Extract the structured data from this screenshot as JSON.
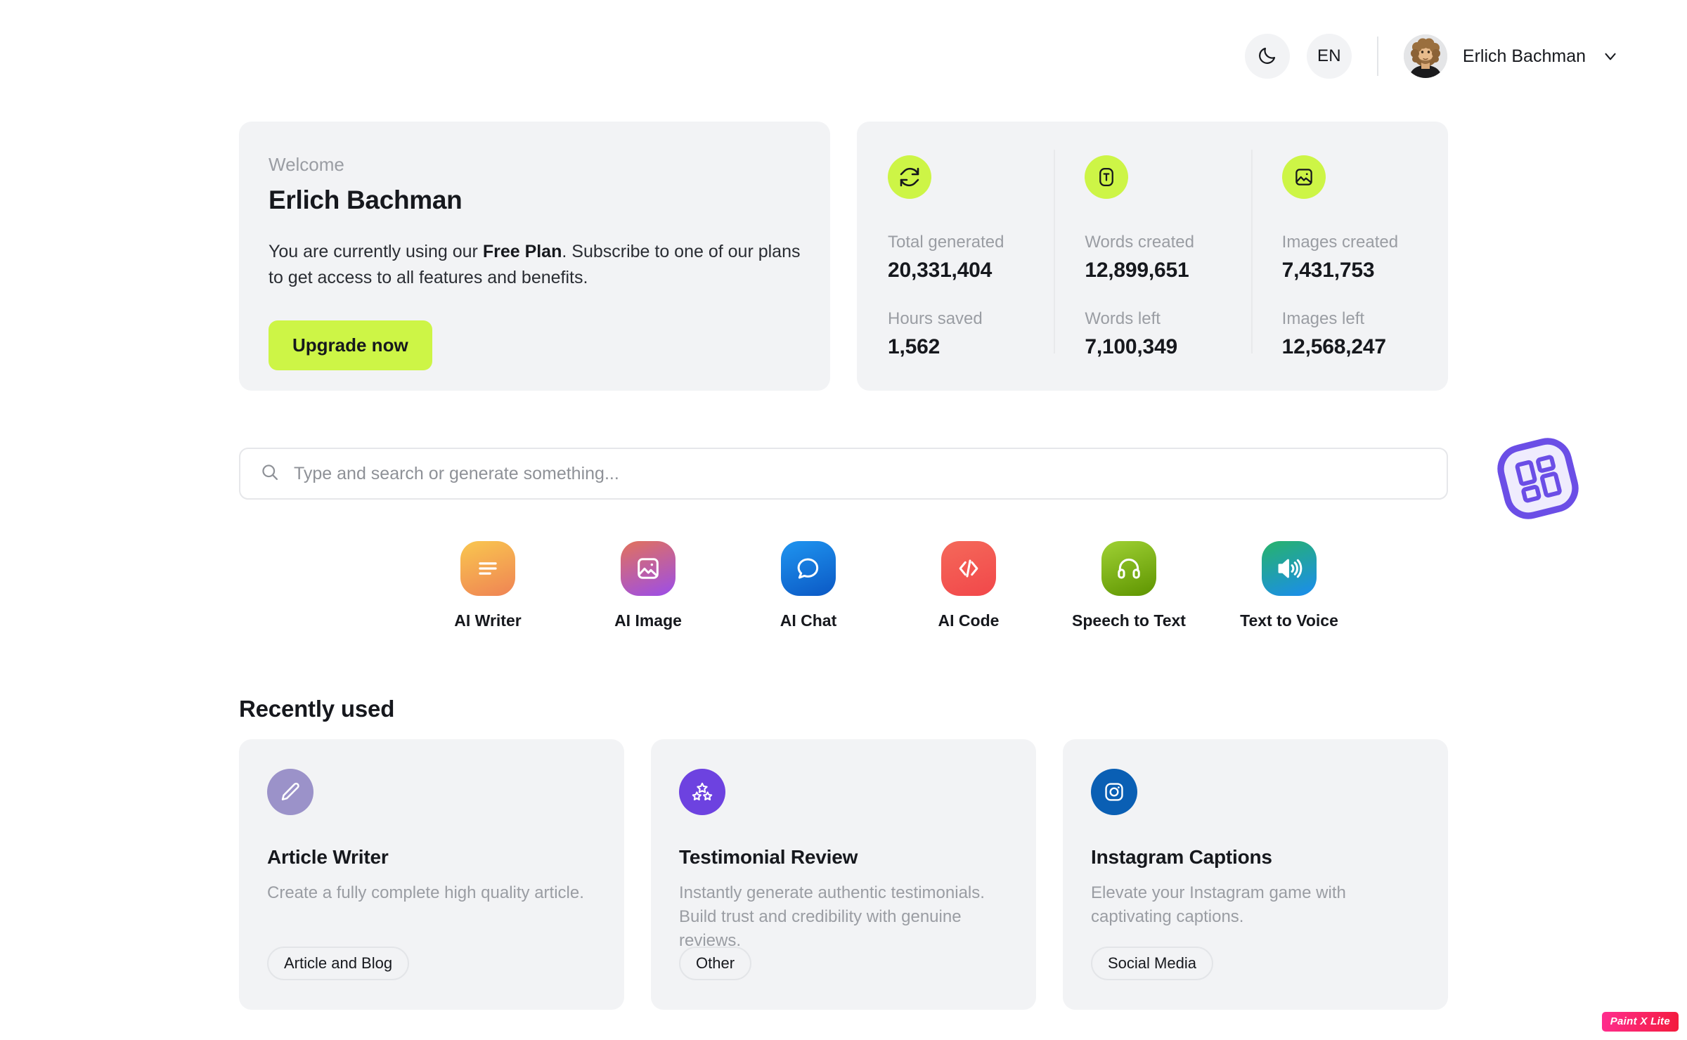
{
  "header": {
    "theme_toggle_icon": "moon-icon",
    "language": "EN",
    "user_name": "Erlich Bachman",
    "chevron_icon": "chevron-down-icon",
    "avatar_alt": "Erlich Bachman"
  },
  "welcome": {
    "eyebrow": "Welcome",
    "name": "Erlich Bachman",
    "desc_before": "You are currently using our ",
    "desc_bold": "Free Plan",
    "desc_after": ". Subscribe to one of our plans to get access to all features and benefits.",
    "upgrade_label": "Upgrade now",
    "accent_color": "#cdf546"
  },
  "stats": {
    "columns": [
      {
        "icon": "sync-refresh-icon",
        "top_label": "Total generated",
        "top_value": "20,331,404",
        "bottom_label": "Hours saved",
        "bottom_value": "1,562"
      },
      {
        "icon": "text-box-icon",
        "top_label": "Words created",
        "top_value": "12,899,651",
        "bottom_label": "Words left",
        "bottom_value": "7,100,349"
      },
      {
        "icon": "image-icon",
        "top_label": "Images created",
        "top_value": "7,431,753",
        "bottom_label": "Images left",
        "bottom_value": "12,568,247"
      }
    ],
    "icon_bg": "#cdf546"
  },
  "search": {
    "placeholder": "Type and search or generate something...",
    "value": "",
    "icon": "search-icon"
  },
  "categories": [
    {
      "label": "AI Writer",
      "icon": "lines-text-icon",
      "color_from": "#f9c74f",
      "color_to": "#ef8354"
    },
    {
      "label": "AI Image",
      "icon": "image-icon",
      "color_from": "#e2725b",
      "color_to": "#9b4dea"
    },
    {
      "label": "AI Chat",
      "icon": "chat-bubble-icon",
      "color_from": "#1f95f0",
      "color_to": "#0b58c4"
    },
    {
      "label": "AI Code",
      "icon": "code-brackets-icon",
      "color_from": "#f4695a",
      "color_to": "#f2474a"
    },
    {
      "label": "Speech to Text",
      "icon": "headphones-icon",
      "color_from": "#9fd134",
      "color_to": "#5e9400"
    },
    {
      "label": "Text to Voice",
      "icon": "speaker-icon",
      "color_from": "#27b36a",
      "color_to": "#1a8cf0"
    }
  ],
  "recently_used": {
    "title": "Recently used",
    "items": [
      {
        "title": "Article Writer",
        "desc": "Create a fully complete high quality article.",
        "tag": "Article and Blog",
        "icon": "pencil-icon",
        "icon_bg": "#9b92c9"
      },
      {
        "title": "Testimonial Review",
        "desc": "Instantly generate authentic testimonials. Build trust and credibility with genuine reviews.",
        "tag": "Other",
        "icon": "three-stars-icon",
        "icon_bg": "#6d42e0"
      },
      {
        "title": "Instagram Captions",
        "desc": "Elevate your Instagram game with captivating captions.",
        "tag": "Social Media",
        "icon": "instagram-icon",
        "icon_bg": "#0a5fb4"
      }
    ]
  },
  "float_widget": {
    "icon": "grid-dashboard-icon",
    "color": "#6b4ee6"
  },
  "watermark": {
    "label": "Paint X Lite"
  }
}
